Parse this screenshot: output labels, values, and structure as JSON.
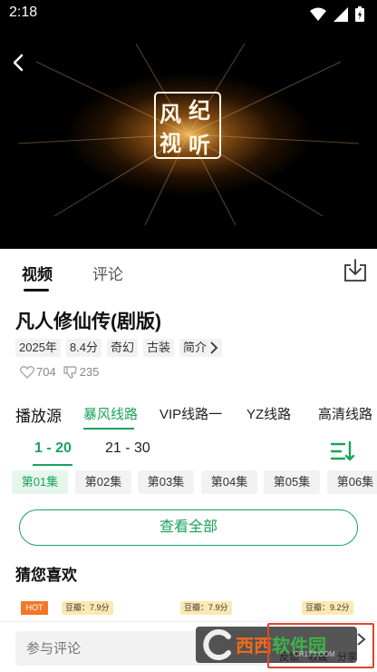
{
  "status_bar": {
    "time": "2:18",
    "icons": [
      "wifi-icon",
      "signal-icon",
      "battery-icon"
    ]
  },
  "video": {
    "logo_chars": [
      "风",
      "纪",
      "视",
      "听"
    ],
    "accent_glow": "#ffbe5a"
  },
  "tabs": [
    {
      "label": "视频",
      "active": true
    },
    {
      "label": "评论",
      "active": false
    }
  ],
  "show": {
    "title": "凡人修仙传(剧版)",
    "tags": [
      "2025年",
      "8.4分",
      "奇幻",
      "古装"
    ],
    "intro_label": "简介",
    "likes": "704",
    "dislikes": "235"
  },
  "sources": {
    "label": "播放源",
    "items": [
      "暴风线路",
      "VIP线路一",
      "YZ线路",
      "高清线路"
    ],
    "active_index": 0
  },
  "ranges": {
    "items": [
      "1 - 20",
      "21 - 30"
    ],
    "active_index": 0
  },
  "episodes": {
    "items": [
      "第01集",
      "第02集",
      "第03集",
      "第04集",
      "第05集",
      "第06集"
    ],
    "active_index": 0
  },
  "view_all_label": "查看全部",
  "recommend": {
    "title": "猜您喜欢",
    "hot_label": "HOT",
    "scores": [
      "豆瓣：7.9分",
      "豆瓣：7.9分",
      "豆瓣：9.2分"
    ]
  },
  "bottom_bar": {
    "comment_placeholder": "参与评论",
    "actions": [
      "反馈",
      "收藏",
      "分享"
    ]
  },
  "watermark": {
    "brand_orange": "西西",
    "brand_green": "软件园",
    "url": "CR173.COM"
  },
  "colors": {
    "accent": "#1aa35b",
    "hot": "#f4772a",
    "score_bg": "#fce9b1"
  }
}
